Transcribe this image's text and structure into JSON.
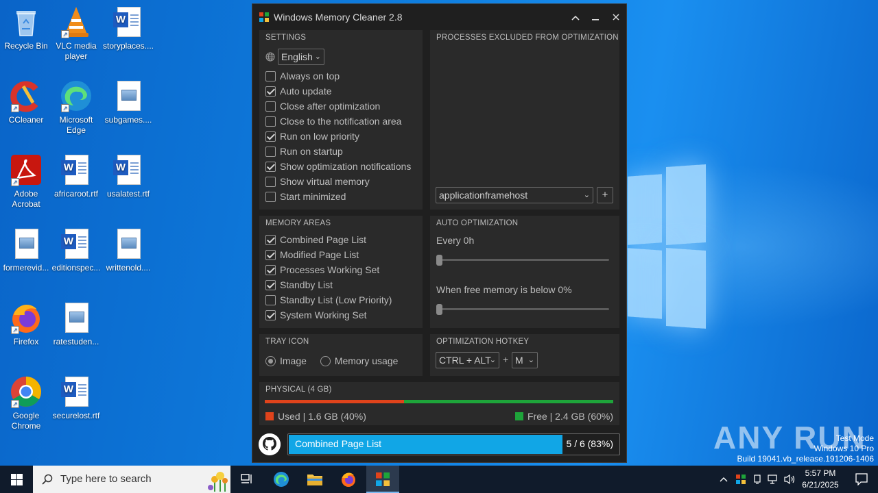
{
  "desktop": {
    "icons": [
      {
        "label": "Recycle Bin",
        "icon": "recycle-bin-icon"
      },
      {
        "label": "VLC media player",
        "icon": "vlc-icon"
      },
      {
        "label": "storyplaces....",
        "icon": "word-doc-icon"
      },
      {
        "label": "CCleaner",
        "icon": "ccleaner-icon"
      },
      {
        "label": "Microsoft Edge",
        "icon": "edge-icon"
      },
      {
        "label": "subgames....",
        "icon": "image-file-icon"
      },
      {
        "label": "Adobe Acrobat",
        "icon": "acrobat-icon"
      },
      {
        "label": "africaroot.rtf",
        "icon": "word-doc-icon"
      },
      {
        "label": "usalatest.rtf",
        "icon": "word-doc-icon"
      },
      {
        "label": "formerevid...",
        "icon": "image-file-icon"
      },
      {
        "label": "editionspec...",
        "icon": "word-doc-icon"
      },
      {
        "label": "writtenold....",
        "icon": "image-file-icon"
      },
      {
        "label": "Firefox",
        "icon": "firefox-icon"
      },
      {
        "label": "ratestuden...",
        "icon": "image-file-icon"
      },
      {
        "label": "Google Chrome",
        "icon": "chrome-icon"
      },
      {
        "label": "securelost.rtf",
        "icon": "word-doc-icon"
      }
    ]
  },
  "app": {
    "title": "Windows Memory Cleaner 2.8",
    "settings": {
      "title": "SETTINGS",
      "language": "English",
      "options": [
        {
          "label": "Always on top",
          "checked": false
        },
        {
          "label": "Auto update",
          "checked": true
        },
        {
          "label": "Close after optimization",
          "checked": false
        },
        {
          "label": "Close to the notification area",
          "checked": false
        },
        {
          "label": "Run on low priority",
          "checked": true
        },
        {
          "label": "Run on startup",
          "checked": false
        },
        {
          "label": "Show optimization notifications",
          "checked": true
        },
        {
          "label": "Show virtual memory",
          "checked": false
        },
        {
          "label": "Start minimized",
          "checked": false
        }
      ]
    },
    "excluded": {
      "title": "PROCESSES EXCLUDED FROM OPTIMIZATION",
      "process_select": "applicationframehost",
      "add_label": "+"
    },
    "memory_areas": {
      "title": "MEMORY AREAS",
      "options": [
        {
          "label": "Combined Page List",
          "checked": true
        },
        {
          "label": "Modified Page List",
          "checked": true
        },
        {
          "label": "Processes Working Set",
          "checked": true
        },
        {
          "label": "Standby List",
          "checked": true
        },
        {
          "label": "Standby List (Low Priority)",
          "checked": false
        },
        {
          "label": "System Working Set",
          "checked": true
        }
      ]
    },
    "auto_optimization": {
      "title": "AUTO OPTIMIZATION",
      "every_label": "Every 0h",
      "every_value": 0,
      "free_label": "When free memory is below 0%",
      "free_value": 0
    },
    "tray_icon": {
      "title": "TRAY ICON",
      "image_label": "Image",
      "memory_label": "Memory usage",
      "selected": "Image"
    },
    "hotkey": {
      "title": "OPTIMIZATION HOTKEY",
      "modifier": "CTRL + ALT",
      "plus": "+",
      "key": "M"
    },
    "physical": {
      "title": "PHYSICAL (4 GB)",
      "used_label": "Used | 1.6 GB (40%)",
      "free_label": "Free | 2.4 GB (60%)",
      "used_fraction": 0.4,
      "used_color": "#e0431b",
      "free_color": "#1ea43a"
    },
    "progress": {
      "label": "Combined Page List",
      "value_text": "5 / 6 (83%)",
      "fraction": 0.83,
      "color": "#11a6e6"
    }
  },
  "watermark": {
    "brand": "ANY RUN",
    "line1": "Test Mode",
    "line2": "Windows 10 Pro",
    "line3": "Build 19041.vb_release.191206-1406"
  },
  "taskbar": {
    "search_placeholder": "Type here to search",
    "time": "5:57 PM",
    "date": "6/21/2025"
  }
}
